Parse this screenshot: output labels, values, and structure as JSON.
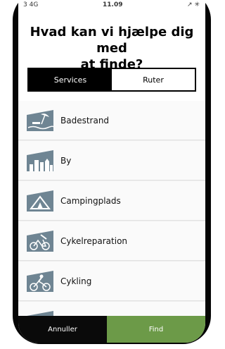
{
  "status_bar": {
    "carrier": "3 4G",
    "time": "11.09",
    "indicators": "↗ ✳"
  },
  "header": {
    "title_line1": "Hvad kan vi hjælpe dig med",
    "title_line2": "at finde?"
  },
  "tabs": [
    {
      "label": "Services",
      "active": true
    },
    {
      "label": "Ruter",
      "active": false
    }
  ],
  "list": {
    "items": [
      {
        "label": "Badestrand",
        "icon": "beach-icon"
      },
      {
        "label": "By",
        "icon": "city-icon"
      },
      {
        "label": "Campingplads",
        "icon": "tent-icon"
      },
      {
        "label": "Cykelreparation",
        "icon": "bike-repair-icon"
      },
      {
        "label": "Cykling",
        "icon": "cycling-icon"
      }
    ]
  },
  "actions": {
    "cancel_label": "Annuller",
    "find_label": "Find"
  },
  "colors": {
    "icon_bg": "#6f8593",
    "find_button": "#6c9a48",
    "active_tab": "#000000"
  }
}
